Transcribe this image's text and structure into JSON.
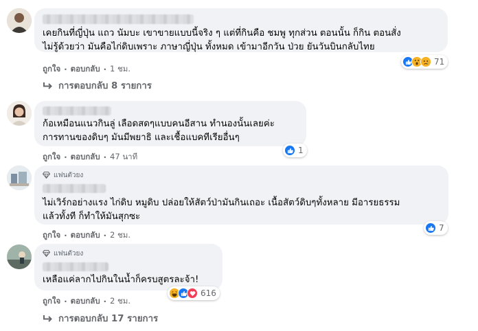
{
  "labels": {
    "like": "ถูกใจ",
    "reply": "ตอบกลับ",
    "separator": "·",
    "fan_badge": "แฟนตัวยง"
  },
  "comments": [
    {
      "text": "เคยกินที่ญี่ปุ่น แถว นัมบะ เขาขายแบบนี้จริง ๆ แต่ที่กินคือ ชมพู ทุกส่วน ตอนนั้น ก็กิน ตอนสั่ง\nไม่รู้ด้วยว่า มันคือไก่ดิบเพราะ ภาษาญี่ปุ่น ทั้งหมด เข้ามาอีกวัน ป่วย ยันวันบินกลับไทย",
      "reactions": [
        "like",
        "wow",
        "sad"
      ],
      "reaction_count": "71",
      "time": "1 ชม.",
      "replies": "การตอบกลับ 8 รายการ"
    },
    {
      "text": "ก้อเหมือนแนวกินลู่ เลือดสดๆแบบคนอีสาน ทำนองนั้นเลยค่ะ\nการทานของดิบๆ มันมีพยาธิ และเชื้อแบคทีเรียอื่นๆ",
      "reactions": [
        "like"
      ],
      "reaction_count": "1",
      "time": "47 นาที"
    },
    {
      "text": "ไม่เวิร์กอย่างแรง ไก่ดิบ หมูดิบ ปล่อยให้สัตว์ป่ามันกินเถอะ เนื้อสัตว์ดิบๆทั้งหลาย มีอารยธรรม\nแล้วทั้งที ก็ทำให้มันสุกซะ",
      "reactions": [
        "like"
      ],
      "reaction_count": "7",
      "time": "2 ชม."
    },
    {
      "text": "เหลือแค่ลากไปกินในน้ำก็ครบสูตรละจ้า!",
      "reactions": [
        "haha",
        "like",
        "love"
      ],
      "reaction_count": "616",
      "time": "2 ชม.",
      "replies": "การตอบกลับ 17 รายการ"
    }
  ],
  "colors": {
    "bubble": "#f0f2f5",
    "meta_text": "#65676b",
    "like_blue": "#1877f2",
    "emoji_yellow": "#f7b125",
    "love_red": "#f33e58"
  }
}
